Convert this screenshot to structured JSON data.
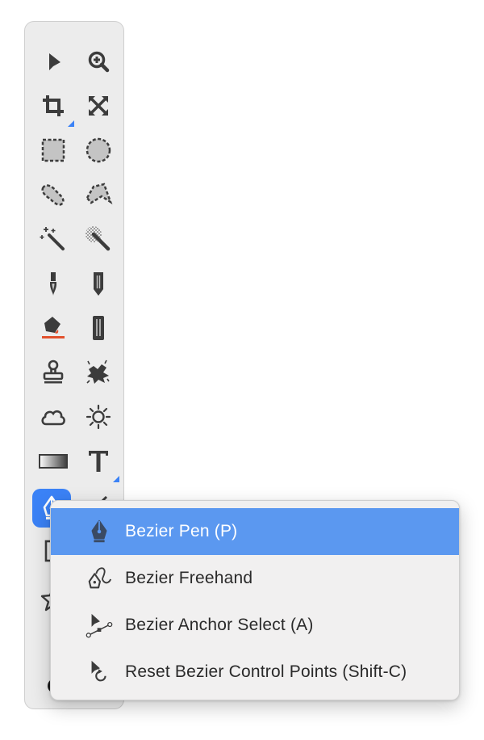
{
  "toolbar": {
    "tools": [
      {
        "name": "move",
        "icon": "arrow-pointer-icon"
      },
      {
        "name": "zoom",
        "icon": "zoom-in-icon"
      },
      {
        "name": "crop",
        "icon": "crop-icon"
      },
      {
        "name": "transform",
        "icon": "expand-arrows-icon"
      },
      {
        "name": "rect-select",
        "icon": "dashed-rectangle-icon"
      },
      {
        "name": "ellipse-select",
        "icon": "dashed-circle-icon"
      },
      {
        "name": "lasso",
        "icon": "lasso-icon"
      },
      {
        "name": "polygon-lasso",
        "icon": "polygon-lasso-icon"
      },
      {
        "name": "magic-wand",
        "icon": "magic-wand-icon"
      },
      {
        "name": "color-select",
        "icon": "soft-wand-icon"
      },
      {
        "name": "paint-brush",
        "icon": "brush-icon"
      },
      {
        "name": "pencil",
        "icon": "pencil-icon"
      },
      {
        "name": "paint-bucket",
        "icon": "paint-bucket-icon"
      },
      {
        "name": "eraser",
        "icon": "eraser-icon"
      },
      {
        "name": "clone-stamp",
        "icon": "stamp-icon"
      },
      {
        "name": "smudge",
        "icon": "smudge-icon"
      },
      {
        "name": "cloud",
        "icon": "cloud-icon"
      },
      {
        "name": "brightness",
        "icon": "sun-icon"
      },
      {
        "name": "gradient",
        "icon": "gradient-icon"
      },
      {
        "name": "text",
        "icon": "text-icon"
      },
      {
        "name": "bezier-pen",
        "icon": "pen-nib-icon"
      }
    ],
    "accent_color": "#3b82f6"
  },
  "menu": {
    "items": [
      {
        "label": "Bezier Pen (P)",
        "icon": "pen-nib-icon",
        "active": true
      },
      {
        "label": "Bezier Freehand",
        "icon": "freehand-pen-icon",
        "active": false
      },
      {
        "label": "Bezier Anchor Select (A)",
        "icon": "anchor-select-icon",
        "active": false
      },
      {
        "label": "Reset Bezier Control Points (Shift-C)",
        "icon": "reset-control-points-icon",
        "active": false
      }
    ],
    "highlight_color": "#5b98f0"
  }
}
